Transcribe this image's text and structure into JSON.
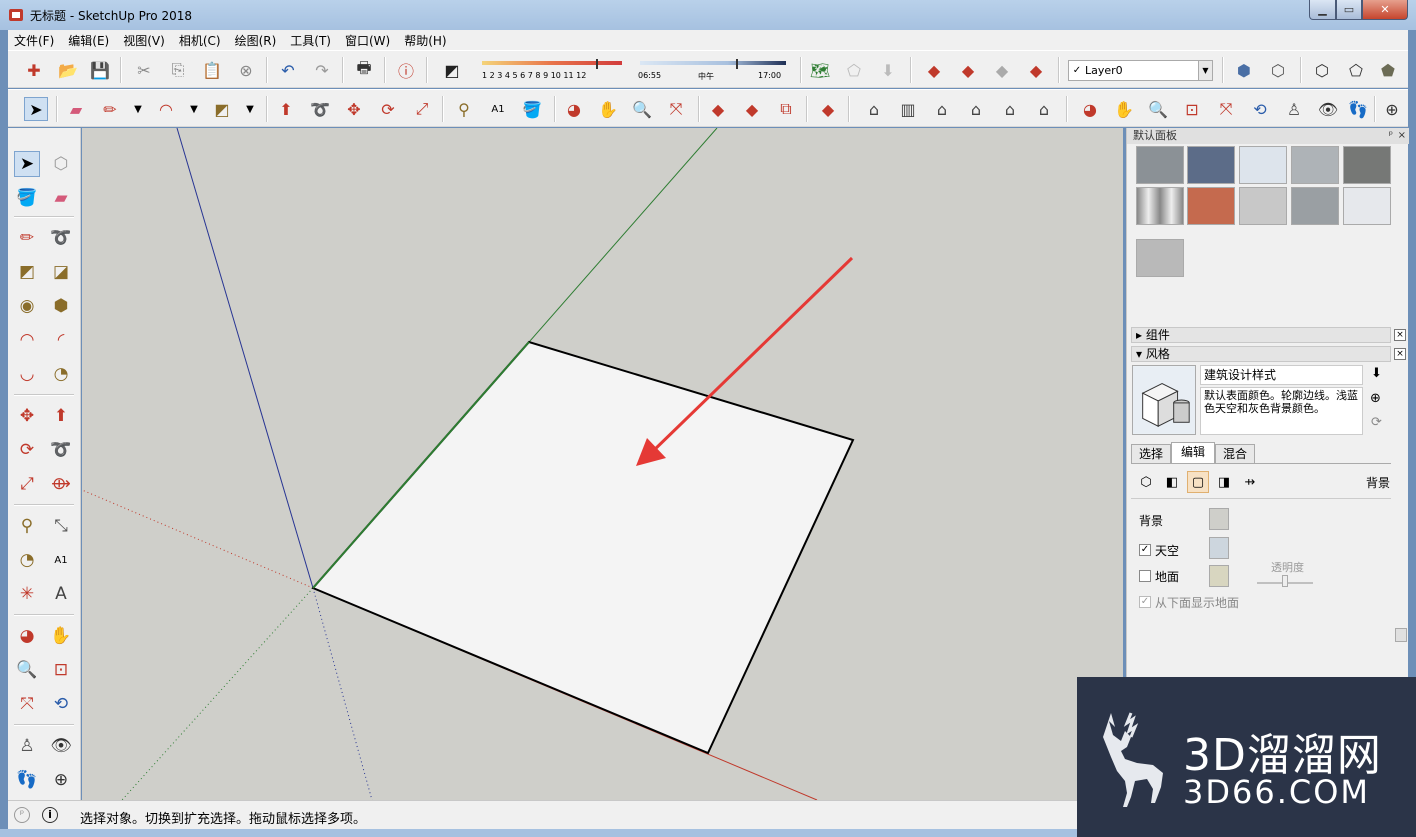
{
  "window": {
    "title": "无标题 - SketchUp Pro 2018",
    "controls": {
      "minimize": "▁",
      "maximize": "▭",
      "close": "✕"
    }
  },
  "menu": [
    "文件(F)",
    "编辑(E)",
    "视图(V)",
    "相机(C)",
    "绘图(R)",
    "工具(T)",
    "窗口(W)",
    "帮助(H)"
  ],
  "shadow_settings": {
    "month_ticks": "1 2 3 4 5 6 7 8 9 10 11 12",
    "time_start": "06:55",
    "time_mid": "中午",
    "time_end": "17:00"
  },
  "layer": {
    "current": "Layer0",
    "check": "✓",
    "dropdown": "▼"
  },
  "tray": {
    "title": "默认面板",
    "pin": "ᵖ",
    "close": "×",
    "materials": [
      {
        "color": "#8b9196"
      },
      {
        "color": "#5c6c88"
      },
      {
        "color": "#dde4ec"
      },
      {
        "color": "#aeb3b7"
      },
      {
        "color": "#767876"
      },
      {
        "color": "#b8b8b8"
      },
      {
        "color": "#c56a4e"
      },
      {
        "color": "#c8c8c8"
      },
      {
        "color": "#9a9fa3"
      },
      {
        "color": "#e6e8ec"
      },
      {
        "color": "#b9b9b9"
      }
    ],
    "components_label": "组件",
    "styles_label": "风格",
    "section_close": "×",
    "style_name": "建筑设计样式",
    "style_description": "默认表面颜色。轮廓边线。浅蓝色天空和灰色背景颜色。",
    "tabs": [
      "选择",
      "编辑",
      "混合"
    ],
    "edit_section_title": "背景",
    "background_label": "背景",
    "sky_label": "天空",
    "ground_label": "地面",
    "show_ground_below_label": "从下面显示地面",
    "transparency_label": "透明度",
    "sky_checked": "✓",
    "show_below_checked": "✓",
    "colors": {
      "background": "#cfcfca",
      "sky": "#cdd6de",
      "ground": "#d8d6c0"
    }
  },
  "status": {
    "hint": "选择对象。切换到扩充选择。拖动鼠标选择多项。"
  },
  "watermark": {
    "title": "3D溜溜网",
    "subtitle": "3D66.COM"
  },
  "colors": {
    "axis_red": "#c0392b",
    "axis_green": "#2e7d32",
    "axis_blue": "#283593",
    "annotation_arrow": "#e53935"
  }
}
